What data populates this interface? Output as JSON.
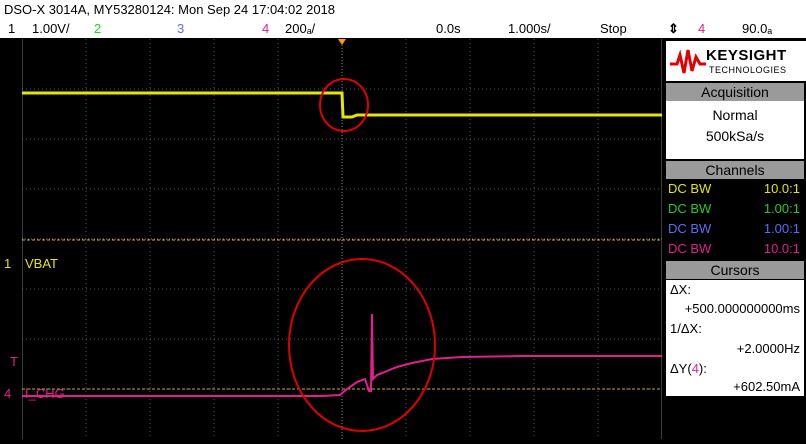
{
  "title": "DSO-X 3014A, MY53280124: Mon Sep 24 17:04:02 2018",
  "status": {
    "ch1_num": "1",
    "ch1_scale": "1.00V/",
    "ch2_num": "2",
    "ch3_num": "3",
    "ch4_num": "4",
    "ch4_scale": "200ₐ/",
    "delay": "0.0s",
    "timebase": "1.000s/",
    "run_state": "Stop",
    "trigger_icon": "⇕",
    "trigger_channel": "4",
    "trigger_level": "90.0ₐ"
  },
  "colors": {
    "ch1": "#e6e600",
    "ch2": "#21d021",
    "ch3": "#5a6cff",
    "ch4": "#e0208c",
    "annotation": "#e00000"
  },
  "logo": {
    "brand": "KEYSIGHT",
    "sub": "TECHNOLOGIES"
  },
  "acquisition": {
    "header": "Acquisition",
    "mode": "Normal",
    "rate": "500kSa/s"
  },
  "channels": {
    "header": "Channels",
    "rows": [
      {
        "coupling": "DC BW",
        "probe": "10.0:1"
      },
      {
        "coupling": "DC BW",
        "probe": "1.00:1"
      },
      {
        "coupling": "DC BW",
        "probe": "1.00:1"
      },
      {
        "coupling": "DC BW",
        "probe": "10.0:1"
      }
    ]
  },
  "cursors": {
    "header": "Cursors",
    "dx_label": "ΔX:",
    "dx_value": "+500.000000000ms",
    "inv_dx_label": "1/ΔX:",
    "inv_dx_value": "+2.0000Hz",
    "dy_label_prefix": "ΔY(",
    "dy_channel": "4",
    "dy_label_suffix": "):",
    "dy_value": "+602.50mA"
  },
  "traces": {
    "ch1_label": "VBAT",
    "ch4_label": "I_CHG",
    "ch1_marker": "1",
    "ch4_marker": "4",
    "trigger_marker": "T"
  }
}
